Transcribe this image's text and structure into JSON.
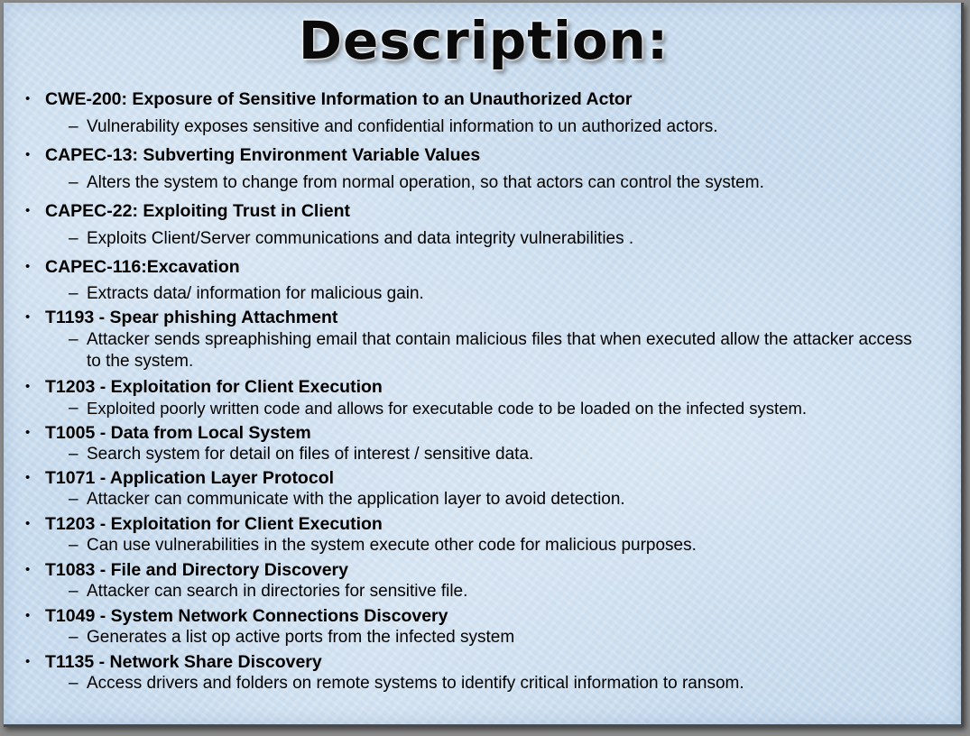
{
  "title": "Description:",
  "items": [
    {
      "head": "CWE-200: Exposure of Sensitive Information to an Unauthorized Actor",
      "sub": "Vulnerability exposes sensitive and confidential information to un authorized actors."
    },
    {
      "head": "CAPEC-13: Subverting Environment Variable Values",
      "sub": "Alters the system to change from normal operation, so  that actors can control the system."
    },
    {
      "head": "CAPEC-22: Exploiting Trust in Client",
      "sub": "Exploits Client/Server communications and data integrity vulnerabilities ."
    },
    {
      "head": "CAPEC-116:Excavation",
      "sub": "Extracts data/ information for malicious gain."
    },
    {
      "head": "T1193 - Spear phishing Attachment",
      "sub": " Attacker sends spreaphishing email that contain malicious files that when executed  allow the attacker access to the system."
    },
    {
      "head": "T1203 - Exploitation for Client Execution",
      "sub": " Exploited poorly written code and allows for executable code to be loaded on the infected system."
    },
    {
      "head": "T1005 - Data from Local System",
      "sub": "Search system for detail on files of interest / sensitive data."
    },
    {
      "head": "T1071 - Application Layer Protocol",
      "sub": "Attacker can communicate with the application layer to avoid detection."
    },
    {
      "head": "T1203 - Exploitation for Client Execution",
      "sub": "Can use vulnerabilities in the system execute other code for malicious purposes."
    },
    {
      "head": "T1083 - File and Directory Discovery",
      "sub": "Attacker can search in directories for sensitive file."
    },
    {
      "head": "T1049 - System Network Connections Discovery",
      "sub": "Generates a list op active ports from the infected system"
    },
    {
      "head": "T1135 - Network Share Discovery",
      "sub": "Access drivers and folders on remote systems to identify critical information to ransom."
    }
  ]
}
